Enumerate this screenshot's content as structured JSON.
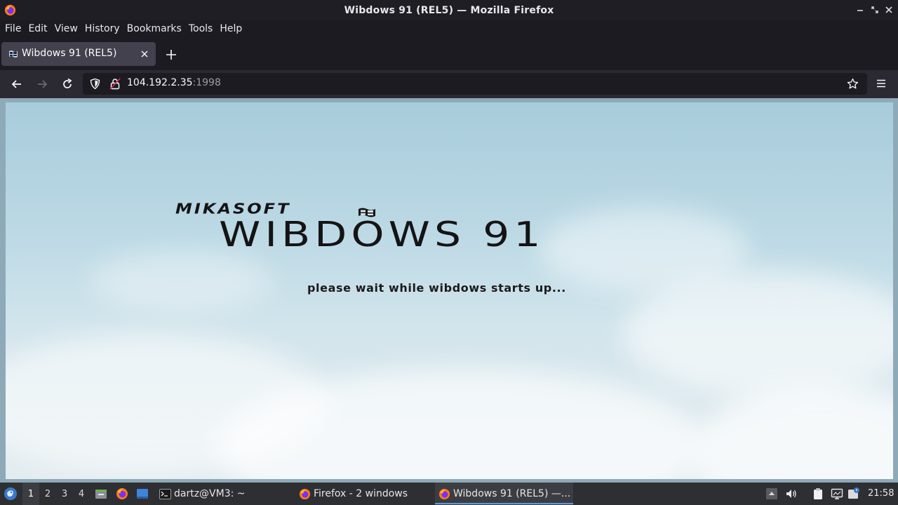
{
  "window": {
    "title": "Wibdows 91 (REL5) — Mozilla Firefox"
  },
  "menubar": {
    "items": [
      "File",
      "Edit",
      "View",
      "History",
      "Bookmarks",
      "Tools",
      "Help"
    ]
  },
  "tabs": [
    {
      "title": "Wibdows 91 (REL5)",
      "icon": "wibdows-flag-icon",
      "active": true
    }
  ],
  "urlbar": {
    "host": "104.192.2.35",
    "port": ":1998"
  },
  "page": {
    "brand": "MIKASOFT",
    "product": "WIBDOWS 91",
    "status": "please wait while wibdows starts up..."
  },
  "taskbar": {
    "workspaces": [
      "1",
      "2",
      "3",
      "4"
    ],
    "active_workspace": "1",
    "tasks": [
      {
        "label": "dartz@VM3: ~",
        "icon": "terminal-icon"
      },
      {
        "label": "Firefox - 2 windows",
        "icon": "firefox-icon"
      },
      {
        "label": "Wibdows 91 (REL5) —...",
        "icon": "firefox-icon",
        "active": true
      }
    ],
    "clock": "21:58"
  },
  "colors": {
    "chrome_dark": "#1c1b22",
    "toolbar": "#2b2a33",
    "tab_active": "#42414d",
    "taskbar": "#2e2f33",
    "accent": "#5b9bd5"
  }
}
